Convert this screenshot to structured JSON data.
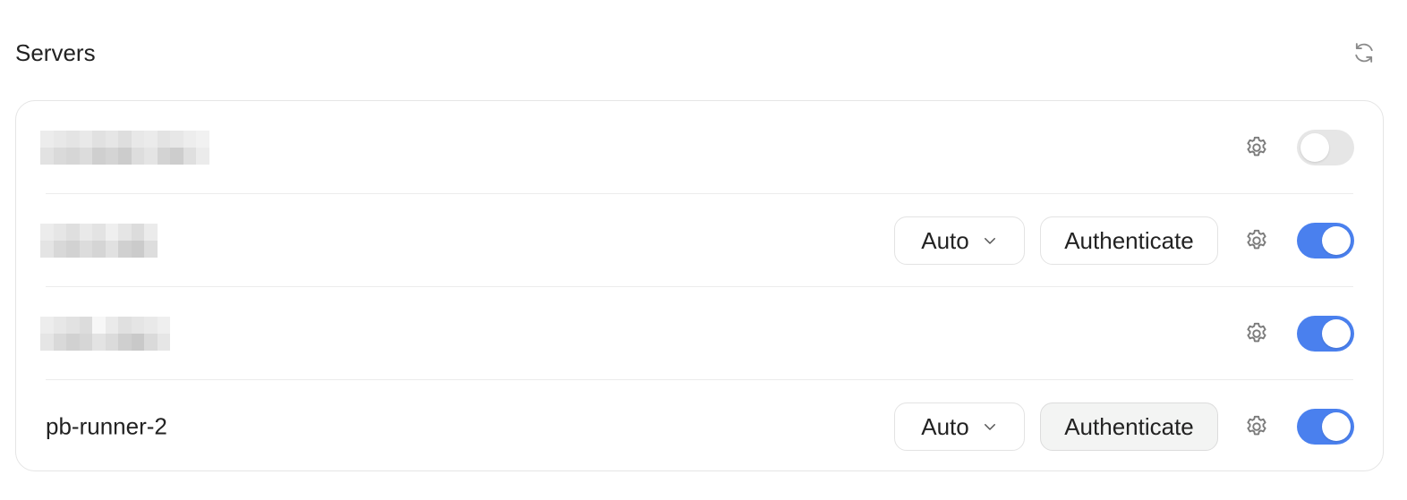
{
  "header": {
    "title": "Servers",
    "refresh_icon": "refresh-icon"
  },
  "colors": {
    "toggle_on": "#4a80ee",
    "toggle_off": "#e6e6e6",
    "border": "#e5e5e5"
  },
  "servers": [
    {
      "name": "",
      "redacted": true,
      "show_auth_controls": false,
      "settings_icon": "gear-icon",
      "enabled": false
    },
    {
      "name": "",
      "redacted": true,
      "show_auth_controls": true,
      "mode": "Auto",
      "auth_label": "Authenticate",
      "settings_icon": "gear-icon",
      "enabled": true
    },
    {
      "name": "",
      "redacted": true,
      "show_auth_controls": false,
      "settings_icon": "gear-icon",
      "enabled": true
    },
    {
      "name": "pb-runner-2",
      "redacted": false,
      "show_auth_controls": true,
      "mode": "Auto",
      "auth_label": "Authenticate",
      "settings_icon": "gear-icon",
      "enabled": true
    }
  ]
}
